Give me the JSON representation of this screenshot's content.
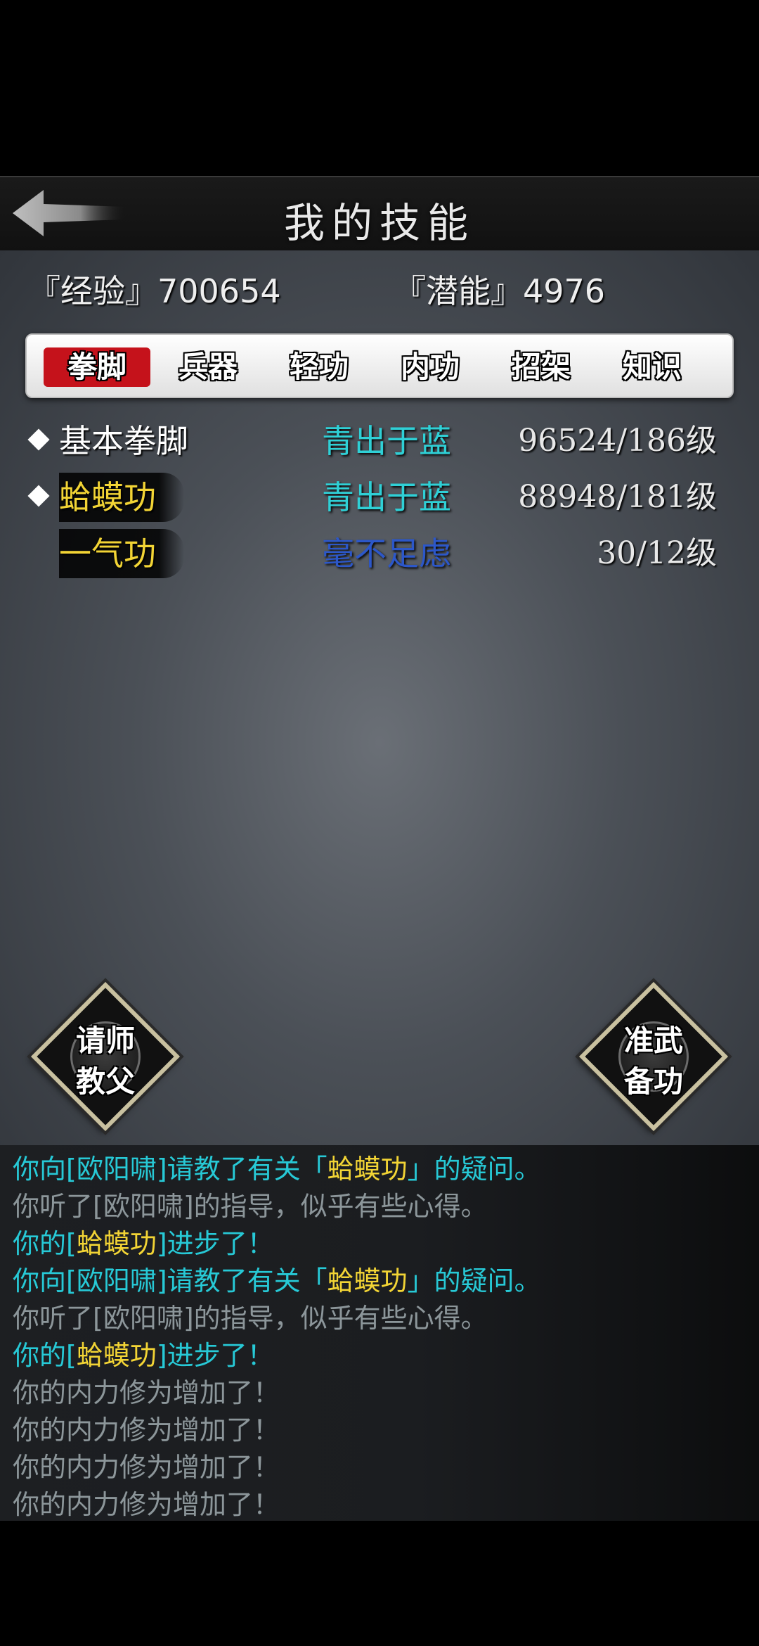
{
  "header": {
    "title": "我的技能",
    "back_icon": "back-arrow-icon"
  },
  "stats": {
    "experience": "『经验』700654",
    "potential": "『潜能』4976"
  },
  "tabs": [
    {
      "label": "拳脚",
      "active": true
    },
    {
      "label": "兵器",
      "active": false
    },
    {
      "label": "轻功",
      "active": false
    },
    {
      "label": "内功",
      "active": false
    },
    {
      "label": "招架",
      "active": false
    },
    {
      "label": "知识",
      "active": false
    }
  ],
  "skills": [
    {
      "name": "基本拳脚",
      "rank": "青出于蓝",
      "level": "96524/186级",
      "name_color": "#ffffff",
      "rank_color": "#2fd0d6"
    },
    {
      "name": "蛤蟆功",
      "rank": "青出于蓝",
      "level": "88948/181级",
      "name_color": "#f2d435",
      "rank_color": "#2fd0d6"
    },
    {
      "name": "一气功",
      "rank": "毫不足虑",
      "level": "30/12级",
      "name_color": "#f2d435",
      "rank_color": "#2c57c9"
    }
  ],
  "buttons": {
    "ask_master": [
      "请师",
      "教父"
    ],
    "prepare_skill": [
      "准武",
      "备功"
    ]
  },
  "log": [
    {
      "parts": [
        {
          "text": "你向[欧阳啸]请教了有关「",
          "color": "cyan"
        },
        {
          "text": "蛤蟆功",
          "color": "yellow"
        },
        {
          "text": "」的疑问。",
          "color": "cyan"
        }
      ]
    },
    {
      "parts": [
        {
          "text": "你听了[欧阳啸]的指导，似乎有些心得。",
          "color": "gray"
        }
      ]
    },
    {
      "parts": [
        {
          "text": "你的[",
          "color": "cyan"
        },
        {
          "text": "蛤蟆功",
          "color": "yellow"
        },
        {
          "text": "]进步了！",
          "color": "cyan"
        }
      ]
    },
    {
      "parts": [
        {
          "text": "你向[欧阳啸]请教了有关「",
          "color": "cyan"
        },
        {
          "text": "蛤蟆功",
          "color": "yellow"
        },
        {
          "text": "」的疑问。",
          "color": "cyan"
        }
      ]
    },
    {
      "parts": [
        {
          "text": "你听了[欧阳啸]的指导，似乎有些心得。",
          "color": "gray"
        }
      ]
    },
    {
      "parts": [
        {
          "text": "你的[",
          "color": "cyan"
        },
        {
          "text": "蛤蟆功",
          "color": "yellow"
        },
        {
          "text": "]进步了！",
          "color": "cyan"
        }
      ]
    },
    {
      "parts": [
        {
          "text": "你的内力修为增加了！",
          "color": "gray"
        }
      ]
    },
    {
      "parts": [
        {
          "text": "你的内力修为增加了！",
          "color": "gray"
        }
      ]
    },
    {
      "parts": [
        {
          "text": "你的内力修为增加了！",
          "color": "gray"
        }
      ]
    },
    {
      "parts": [
        {
          "text": "你的内力修为增加了！",
          "color": "gray"
        }
      ]
    }
  ]
}
